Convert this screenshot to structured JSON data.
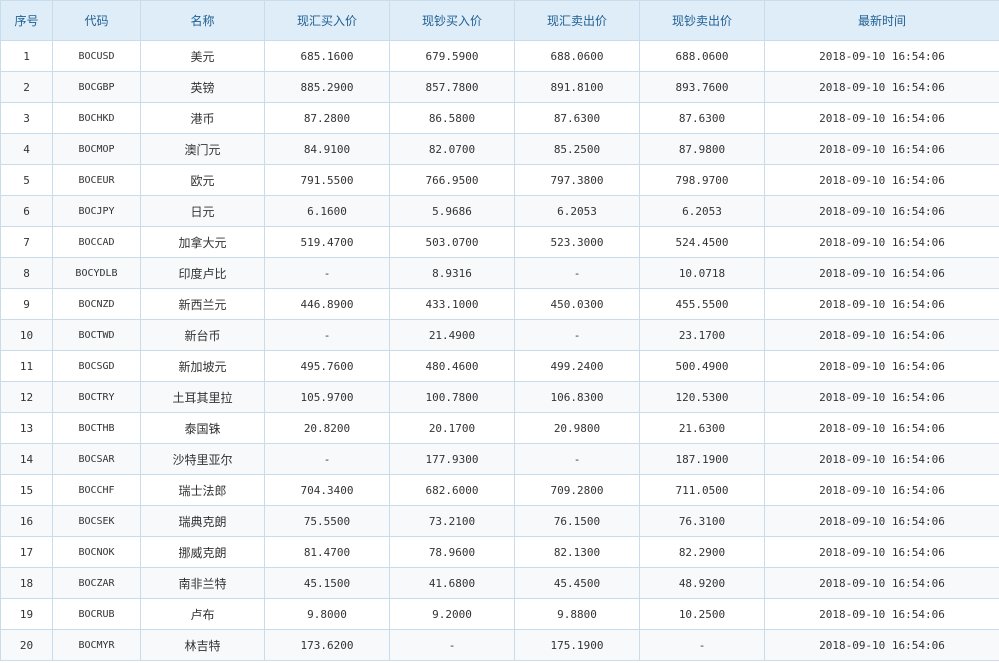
{
  "headers": [
    "序号",
    "代码",
    "名称",
    "现汇买入价",
    "现钞买入价",
    "现汇卖出价",
    "现钞卖出价",
    "最新时间"
  ],
  "rows": [
    {
      "no": "1",
      "code": "BOCUSD",
      "name": "美元",
      "xh_buy": "685.1600",
      "xc_buy": "679.5900",
      "xh_sell": "688.0600",
      "xc_sell": "688.0600",
      "time": "2018-09-10 16:54:06"
    },
    {
      "no": "2",
      "code": "BOCGBP",
      "name": "英镑",
      "xh_buy": "885.2900",
      "xc_buy": "857.7800",
      "xh_sell": "891.8100",
      "xc_sell": "893.7600",
      "time": "2018-09-10 16:54:06"
    },
    {
      "no": "3",
      "code": "BOCHKD",
      "name": "港币",
      "xh_buy": "87.2800",
      "xc_buy": "86.5800",
      "xh_sell": "87.6300",
      "xc_sell": "87.6300",
      "time": "2018-09-10 16:54:06"
    },
    {
      "no": "4",
      "code": "BOCMOP",
      "name": "澳门元",
      "xh_buy": "84.9100",
      "xc_buy": "82.0700",
      "xh_sell": "85.2500",
      "xc_sell": "87.9800",
      "time": "2018-09-10 16:54:06"
    },
    {
      "no": "5",
      "code": "BOCEUR",
      "name": "欧元",
      "xh_buy": "791.5500",
      "xc_buy": "766.9500",
      "xh_sell": "797.3800",
      "xc_sell": "798.9700",
      "time": "2018-09-10 16:54:06"
    },
    {
      "no": "6",
      "code": "BOCJPY",
      "name": "日元",
      "xh_buy": "6.1600",
      "xc_buy": "5.9686",
      "xh_sell": "6.2053",
      "xc_sell": "6.2053",
      "time": "2018-09-10 16:54:06"
    },
    {
      "no": "7",
      "code": "BOCCAD",
      "name": "加拿大元",
      "xh_buy": "519.4700",
      "xc_buy": "503.0700",
      "xh_sell": "523.3000",
      "xc_sell": "524.4500",
      "time": "2018-09-10 16:54:06"
    },
    {
      "no": "8",
      "code": "BOCYDLB",
      "name": "印度卢比",
      "xh_buy": "-",
      "xc_buy": "8.9316",
      "xh_sell": "-",
      "xc_sell": "10.0718",
      "time": "2018-09-10 16:54:06"
    },
    {
      "no": "9",
      "code": "BOCNZD",
      "name": "新西兰元",
      "xh_buy": "446.8900",
      "xc_buy": "433.1000",
      "xh_sell": "450.0300",
      "xc_sell": "455.5500",
      "time": "2018-09-10 16:54:06"
    },
    {
      "no": "10",
      "code": "BOCTWD",
      "name": "新台币",
      "xh_buy": "-",
      "xc_buy": "21.4900",
      "xh_sell": "-",
      "xc_sell": "23.1700",
      "time": "2018-09-10 16:54:06"
    },
    {
      "no": "11",
      "code": "BOCSGD",
      "name": "新加坡元",
      "xh_buy": "495.7600",
      "xc_buy": "480.4600",
      "xh_sell": "499.2400",
      "xc_sell": "500.4900",
      "time": "2018-09-10 16:54:06"
    },
    {
      "no": "12",
      "code": "BOCTRY",
      "name": "土耳其里拉",
      "xh_buy": "105.9700",
      "xc_buy": "100.7800",
      "xh_sell": "106.8300",
      "xc_sell": "120.5300",
      "time": "2018-09-10 16:54:06"
    },
    {
      "no": "13",
      "code": "BOCTHB",
      "name": "泰国铢",
      "xh_buy": "20.8200",
      "xc_buy": "20.1700",
      "xh_sell": "20.9800",
      "xc_sell": "21.6300",
      "time": "2018-09-10 16:54:06"
    },
    {
      "no": "14",
      "code": "BOCSAR",
      "name": "沙特里亚尔",
      "xh_buy": "-",
      "xc_buy": "177.9300",
      "xh_sell": "-",
      "xc_sell": "187.1900",
      "time": "2018-09-10 16:54:06"
    },
    {
      "no": "15",
      "code": "BOCCHF",
      "name": "瑞士法郎",
      "xh_buy": "704.3400",
      "xc_buy": "682.6000",
      "xh_sell": "709.2800",
      "xc_sell": "711.0500",
      "time": "2018-09-10 16:54:06"
    },
    {
      "no": "16",
      "code": "BOCSEK",
      "name": "瑞典克朗",
      "xh_buy": "75.5500",
      "xc_buy": "73.2100",
      "xh_sell": "76.1500",
      "xc_sell": "76.3100",
      "time": "2018-09-10 16:54:06"
    },
    {
      "no": "17",
      "code": "BOCNOK",
      "name": "挪威克朗",
      "xh_buy": "81.4700",
      "xc_buy": "78.9600",
      "xh_sell": "82.1300",
      "xc_sell": "82.2900",
      "time": "2018-09-10 16:54:06"
    },
    {
      "no": "18",
      "code": "BOCZAR",
      "name": "南非兰特",
      "xh_buy": "45.1500",
      "xc_buy": "41.6800",
      "xh_sell": "45.4500",
      "xc_sell": "48.9200",
      "time": "2018-09-10 16:54:06"
    },
    {
      "no": "19",
      "code": "BOCRUB",
      "name": "卢布",
      "xh_buy": "9.8000",
      "xc_buy": "9.2000",
      "xh_sell": "9.8800",
      "xc_sell": "10.2500",
      "time": "2018-09-10 16:54:06"
    },
    {
      "no": "20",
      "code": "BOCMYR",
      "name": "林吉特",
      "xh_buy": "173.6200",
      "xc_buy": "-",
      "xh_sell": "175.1900",
      "xc_sell": "-",
      "time": "2018-09-10 16:54:06"
    }
  ]
}
